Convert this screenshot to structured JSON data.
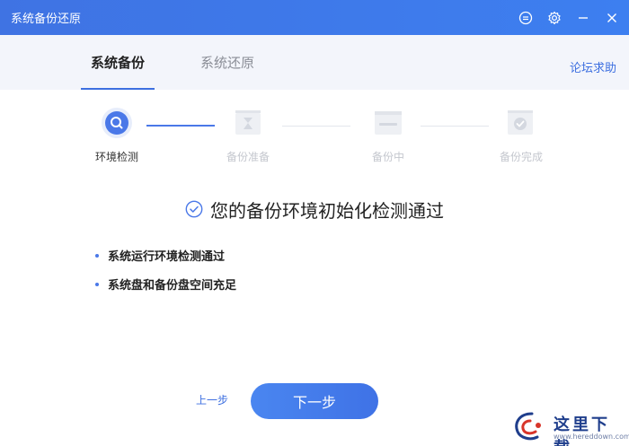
{
  "window": {
    "title": "系统备份还原"
  },
  "tabs": [
    {
      "label": "系统备份",
      "active": true
    },
    {
      "label": "系统还原",
      "active": false
    }
  ],
  "forum_link": "论坛求助",
  "steps": [
    {
      "label": "环境检测",
      "icon": "search-icon",
      "state": "active"
    },
    {
      "label": "备份准备",
      "icon": "hourglass-icon",
      "state": "pending"
    },
    {
      "label": "备份中",
      "icon": "progress-icon",
      "state": "pending"
    },
    {
      "label": "备份完成",
      "icon": "check-icon",
      "state": "pending"
    }
  ],
  "result": {
    "message": "您的备份环境初始化检测通过"
  },
  "check_items": [
    "系统运行环境检测通过",
    "系统盘和备份盘空间充足"
  ],
  "buttons": {
    "prev": "上一步",
    "next": "下一步"
  },
  "watermark": {
    "text": "这里下载",
    "url": "www.hereddown.com"
  },
  "colors": {
    "accent": "#3d6fe0",
    "titlebar": "#3f73e3",
    "tabbar_bg": "#f3f5fb",
    "inactive": "#c4c7ce"
  }
}
